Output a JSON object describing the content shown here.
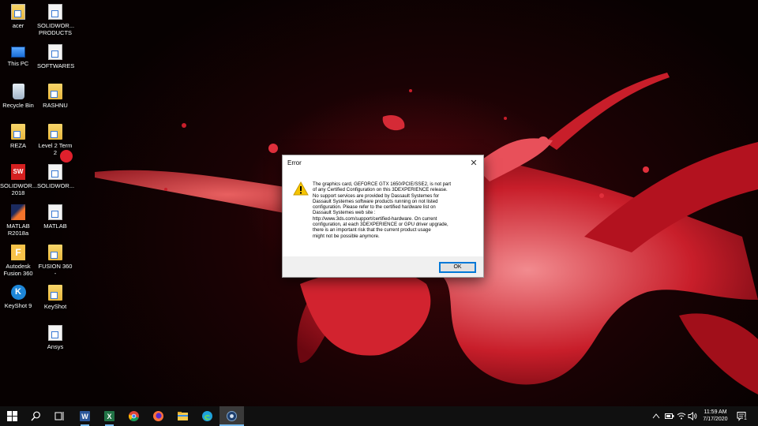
{
  "desktop": {
    "icons": [
      {
        "label": "acer",
        "icon": "user-folder-icon"
      },
      {
        "label": "SOLIDWOR... PRODUCTS",
        "icon": "shortcut-icon"
      },
      {
        "label": "This PC",
        "icon": "computer-icon"
      },
      {
        "label": "SOFTWARES",
        "icon": "shortcut-icon"
      },
      {
        "label": "Recycle Bin",
        "icon": "recycle-bin-icon"
      },
      {
        "label": "RASHNU",
        "icon": "folder-shortcut-icon"
      },
      {
        "label": "REZA",
        "icon": "folder-shortcut-icon"
      },
      {
        "label": "Level 2 Term 2",
        "icon": "folder-shortcut-icon"
      },
      {
        "label": "SOLIDWOR... 2018",
        "icon": "solidworks-icon"
      },
      {
        "label": "SOLIDWOR...",
        "icon": "shortcut-icon"
      },
      {
        "label": "MATLAB R2018a",
        "icon": "matlab-icon"
      },
      {
        "label": "MATLAB",
        "icon": "shortcut-icon"
      },
      {
        "label": "Autodesk Fusion 360",
        "icon": "fusion-icon"
      },
      {
        "label": "FUSION 360 -",
        "icon": "folder-shortcut-icon"
      },
      {
        "label": "KeyShot 9",
        "icon": "keyshot-icon"
      },
      {
        "label": "KeyShot",
        "icon": "folder-shortcut-icon"
      },
      {
        "label": "Ansys",
        "icon": "shortcut-icon"
      }
    ]
  },
  "dialog": {
    "title": "Error",
    "close_glyph": "✕",
    "icon": "warning-icon",
    "message": "The graphics card, GEFORCE GTX 1650/PCIE/SSE2, is not part\nof any Certified Configuration on this 3DEXPERIENCE release.\nNo support services are provided by Dassault Systemes for\nDassault Systemes software products running on not listed\nconfiguration. Please refer to the certified hardware list on\nDassault Systemes web site :\nhttp://www.3ds.com/support/certified-hardware. On current\nconfiguration, at each 3DEXPERIENCE or GPU driver upgrade,\nthere is an important risk that the current product usage\nmight not be possible anymore.",
    "ok_label": "OK"
  },
  "taskbar": {
    "apps": [
      "start-icon",
      "search-icon",
      "task-view-icon",
      "word-icon",
      "excel-icon",
      "chrome-icon",
      "firefox-icon",
      "file-explorer-icon",
      "edge-icon",
      "3dexperience-icon"
    ],
    "time": "11:59 AM",
    "date": "7/17/2020",
    "tray": [
      "chevron-up-icon",
      "battery-icon",
      "wifi-icon",
      "volume-icon",
      "notification-icon"
    ],
    "notification_count": "1"
  },
  "colors": {
    "accent": "#0078d7",
    "warning": "#f5c400",
    "taskbar": "#101010"
  }
}
